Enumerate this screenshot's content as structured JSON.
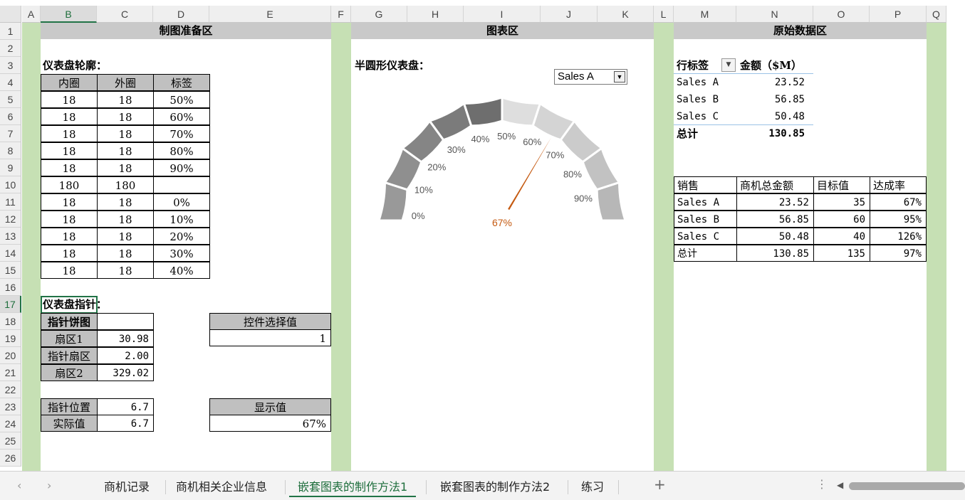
{
  "columns": [
    "A",
    "B",
    "C",
    "D",
    "E",
    "F",
    "G",
    "H",
    "I",
    "J",
    "K",
    "L",
    "M",
    "N",
    "O",
    "P",
    "Q"
  ],
  "rows": [
    "1",
    "2",
    "3",
    "4",
    "5",
    "6",
    "7",
    "8",
    "9",
    "10",
    "11",
    "12",
    "13",
    "14",
    "15",
    "16",
    "17",
    "18",
    "19",
    "20",
    "21",
    "22",
    "23",
    "24",
    "25",
    "26"
  ],
  "sections": {
    "prep": "制图准备区",
    "chart": "图表区",
    "raw": "原始数据区"
  },
  "outline": {
    "title": "仪表盘轮廓：",
    "headers": [
      "内圈",
      "外圈",
      "标签"
    ],
    "rows": [
      [
        "18",
        "18",
        "50%"
      ],
      [
        "18",
        "18",
        "60%"
      ],
      [
        "18",
        "18",
        "70%"
      ],
      [
        "18",
        "18",
        "80%"
      ],
      [
        "18",
        "18",
        "90%"
      ],
      [
        "180",
        "180",
        ""
      ],
      [
        "18",
        "18",
        "0%"
      ],
      [
        "18",
        "18",
        "10%"
      ],
      [
        "18",
        "18",
        "20%"
      ],
      [
        "18",
        "18",
        "30%"
      ],
      [
        "18",
        "18",
        "40%"
      ]
    ]
  },
  "pointer": {
    "title": "仪表盘指针：",
    "pie_label": "指针饼图",
    "rows": [
      [
        "扇区1",
        "30.98"
      ],
      [
        "指针扇区",
        "2.00"
      ],
      [
        "扇区2",
        "329.02"
      ]
    ],
    "position_label": "指针位置",
    "position_value": "6.7",
    "actual_label": "实际值",
    "actual_value": "6.7"
  },
  "control": {
    "label": "控件选择值",
    "value": "1"
  },
  "display": {
    "label": "显示值",
    "value": "67%"
  },
  "gauge": {
    "title": "半圆形仪表盘：",
    "dropdown_value": "Sales A",
    "ticks": [
      "0%",
      "10%",
      "20%",
      "30%",
      "40%",
      "50%",
      "60%",
      "70%",
      "80%",
      "90%"
    ],
    "needle_value": 0.67,
    "needle_label": "67%",
    "colors": {
      "left": [
        "#999999",
        "#8f8f8f",
        "#858585",
        "#7b7b7b",
        "#6e6e6e"
      ],
      "right": [
        "#dedede",
        "#d4d4d4",
        "#cbcbcb",
        "#c2c2c2",
        "#b7b7b7"
      ],
      "needle": "#c55a11"
    }
  },
  "pivot": {
    "header_label": "行标签",
    "header_value": "金额（$M）",
    "rows": [
      [
        "Sales A",
        "23.52"
      ],
      [
        "Sales B",
        "56.85"
      ],
      [
        "Sales C",
        "50.48"
      ]
    ],
    "total_label": "总计",
    "total_value": "130.85"
  },
  "sales_table": {
    "headers": [
      "销售",
      "商机总金额",
      "目标值",
      "达成率"
    ],
    "rows": [
      [
        "Sales A",
        "23.52",
        "35",
        "67%"
      ],
      [
        "Sales B",
        "56.85",
        "60",
        "95%"
      ],
      [
        "Sales C",
        "50.48",
        "40",
        "126%"
      ],
      [
        "总计",
        "130.85",
        "135",
        "97%"
      ]
    ]
  },
  "tabs": [
    "商机记录",
    "商机相关企业信息",
    "嵌套图表的制作方法1",
    "嵌套图表的制作方法2",
    "练习"
  ],
  "active_tab": 2
}
